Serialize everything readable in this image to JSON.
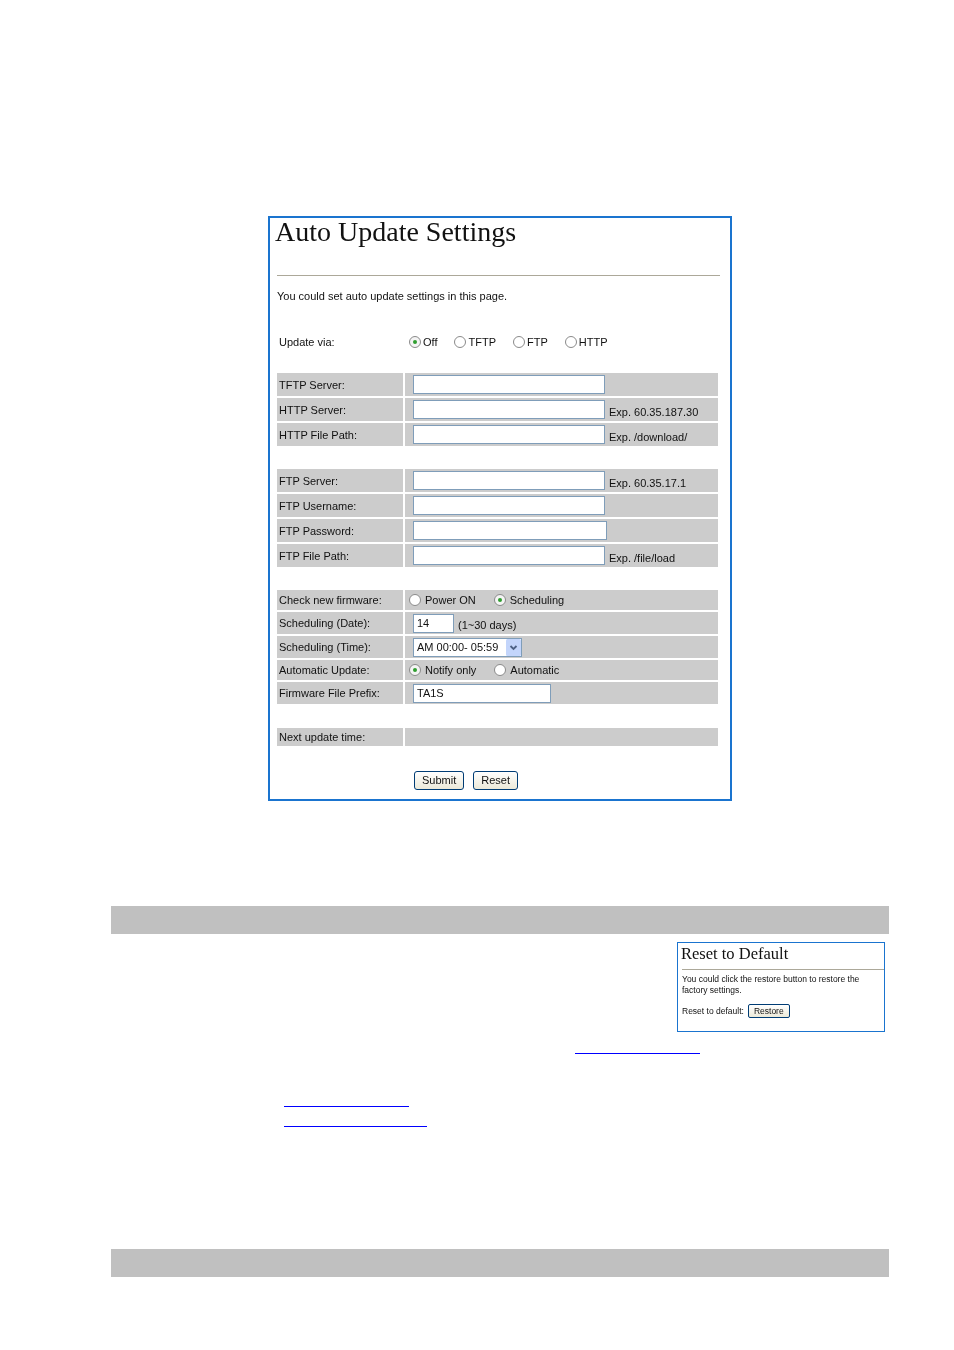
{
  "auto_update_figure": {
    "title": "Auto Update Settings",
    "description": "You could set auto update settings in this page.",
    "update_via": {
      "label": "Update via:",
      "options": [
        {
          "label": "Off",
          "selected": true
        },
        {
          "label": "TFTP",
          "selected": false
        },
        {
          "label": "FTP",
          "selected": false
        },
        {
          "label": "HTTP",
          "selected": false
        }
      ]
    },
    "groups": [
      {
        "rows": [
          {
            "kind": "text",
            "label": "TFTP Server:"
          },
          {
            "kind": "text",
            "label": "HTTP Server:",
            "note": "Exp. 60.35.187.30"
          },
          {
            "kind": "text",
            "label": "HTTP File Path:",
            "note": "Exp. /download/"
          }
        ]
      },
      {
        "rows": [
          {
            "kind": "text",
            "label": "FTP Server:",
            "note": "Exp. 60.35.17.1"
          },
          {
            "kind": "text",
            "label": "FTP Username:"
          },
          {
            "kind": "password",
            "label": "FTP Password:"
          },
          {
            "kind": "text",
            "label": "FTP File Path:",
            "note": "Exp. /file/load"
          }
        ]
      },
      {
        "rows": [
          {
            "kind": "radio",
            "label": "Check new firmware:",
            "options": [
              {
                "label": "Power ON",
                "selected": false
              },
              {
                "label": "Scheduling",
                "selected": true
              }
            ]
          },
          {
            "kind": "number",
            "label": "Scheduling (Date):",
            "value": "14",
            "note": "(1~30 days)"
          },
          {
            "kind": "select",
            "label": "Scheduling (Time):",
            "value": "AM 00:00- 05:59"
          },
          {
            "kind": "radio",
            "label": "Automatic Update:",
            "options": [
              {
                "label": "Notify only",
                "selected": true
              },
              {
                "label": "Automatic",
                "selected": false
              }
            ]
          },
          {
            "kind": "text",
            "label": "Firmware File Prefix:",
            "value": "TA1S"
          }
        ]
      },
      {
        "rows": [
          {
            "kind": "readout",
            "label": "Next update time:"
          }
        ]
      }
    ],
    "buttons": [
      "Submit",
      "Reset"
    ]
  },
  "reset_figure": {
    "title": "Reset to Default",
    "description": "You could click the restore button to restore the factory settings.",
    "label": "Reset to default:",
    "button": "Restore"
  }
}
